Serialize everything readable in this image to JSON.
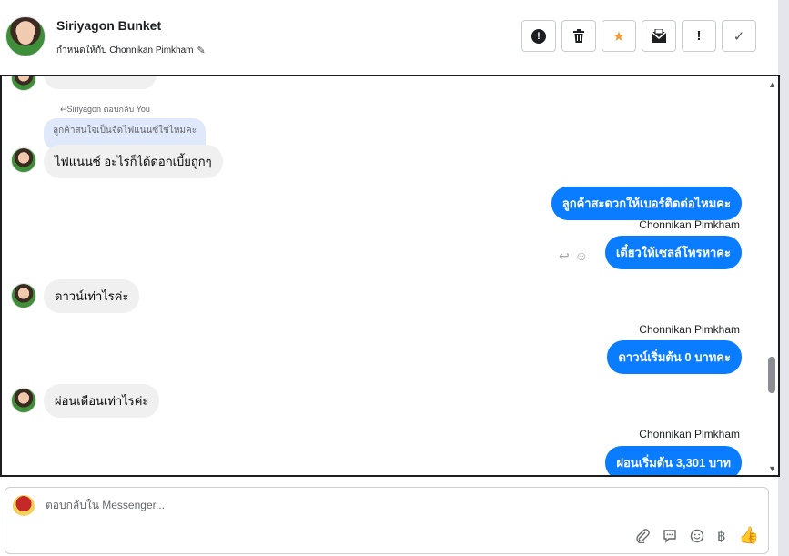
{
  "header": {
    "contact_name": "Siriyagon Bunket",
    "assign_label": "กำหนดให้กับ Chonnikan Pimkham",
    "actions": [
      {
        "name": "report-icon",
        "glyph": "!"
      },
      {
        "name": "trash-icon",
        "glyph": "🗑"
      },
      {
        "name": "star-icon",
        "glyph": "★"
      },
      {
        "name": "mark-unread-icon",
        "glyph": "✉"
      },
      {
        "name": "spam-icon",
        "glyph": "!"
      },
      {
        "name": "done-icon",
        "glyph": "✓"
      }
    ]
  },
  "conversation": {
    "reply_meta": "Siriyagon ตอบกลับ You",
    "quoted_text": "ลูกค้าสนใจเป็นจัดไฟแนนซ์ใช่ไหมคะ",
    "messages": [
      {
        "from": "customer",
        "text": "ไฟแนนซ์ อะไรก็ได้ดอกเบี้ยถูกๆ"
      },
      {
        "from": "agent",
        "text": "ลูกค้าสะดวกให้เบอร์ติดต่อไหมคะ"
      },
      {
        "from": "agent",
        "sender": "Chonnikan Pimkham",
        "text": "เดี๋ยวให้เซลล์โทรหาคะ"
      },
      {
        "from": "customer",
        "text": "ดาวน์เท่าไรค่ะ"
      },
      {
        "from": "agent",
        "sender": "Chonnikan Pimkham",
        "text": "ดาวน์เริ่มต้น 0 บาทคะ"
      },
      {
        "from": "customer",
        "text": "ผ่อนเดือนเท่าไรค่ะ"
      },
      {
        "from": "agent",
        "sender": "Chonnikan Pimkham",
        "text": "ผ่อนเริ่มต้น 3,301 บาท"
      }
    ]
  },
  "composer": {
    "placeholder": "ตอบกลับใน Messenger...",
    "tools": [
      "attach-icon",
      "saved-reply-icon",
      "emoji-icon",
      "baht-icon",
      "like-icon"
    ]
  }
}
